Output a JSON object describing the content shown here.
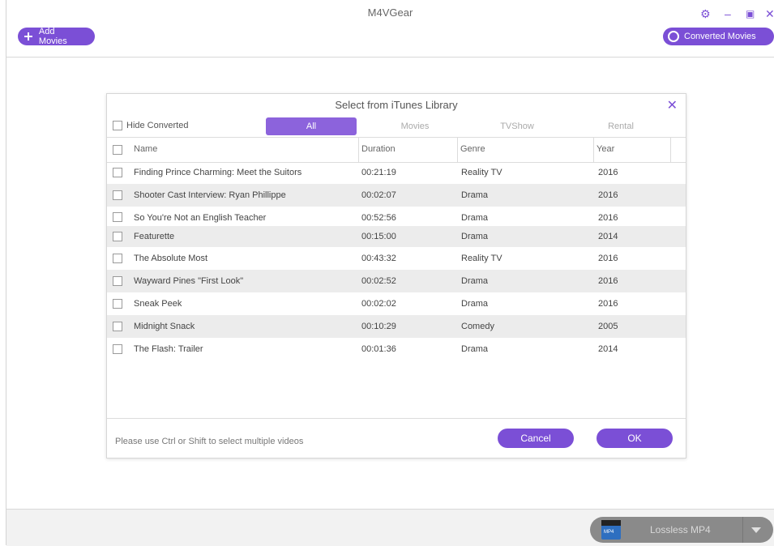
{
  "app": {
    "title": "M4VGear",
    "add_movies_label": "Add Movies",
    "converted_movies_label": "Converted Movies",
    "accent_color": "#7b4fd6"
  },
  "window_controls": {
    "settings_icon": "gear-icon",
    "minimize_icon": "minimize-icon",
    "maximize_icon": "maximize-icon",
    "close_icon": "close-icon"
  },
  "dialog": {
    "title": "Select from iTunes Library",
    "hide_converted_label": "Hide Converted",
    "tabs": [
      {
        "label": "All",
        "active": true
      },
      {
        "label": "Movies",
        "active": false
      },
      {
        "label": "TVShow",
        "active": false
      },
      {
        "label": "Rental",
        "active": false
      }
    ],
    "columns": [
      "Name",
      "Duration",
      "Genre",
      "Year"
    ],
    "rows": [
      {
        "name": "Finding Prince Charming: Meet the Suitors",
        "duration": "00:21:19",
        "genre": "Reality TV",
        "year": "2016"
      },
      {
        "name": "Shooter Cast Interview: Ryan Phillippe",
        "duration": "00:02:07",
        "genre": "Drama",
        "year": "2016"
      },
      {
        "name": "So You're Not an English Teacher",
        "duration": "00:52:56",
        "genre": "Drama",
        "year": "2016"
      },
      {
        "name": "Featurette",
        "duration": "00:15:00",
        "genre": "Drama",
        "year": "2014"
      },
      {
        "name": "The Absolute Most",
        "duration": "00:43:32",
        "genre": "Reality TV",
        "year": "2016"
      },
      {
        "name": "Wayward Pines \"First Look\"",
        "duration": "00:02:52",
        "genre": "Drama",
        "year": "2016"
      },
      {
        "name": "Sneak Peek",
        "duration": "00:02:02",
        "genre": "Drama",
        "year": "2016"
      },
      {
        "name": "Midnight Snack",
        "duration": "00:10:29",
        "genre": "Comedy",
        "year": "2005"
      },
      {
        "name": "The Flash: Trailer",
        "duration": "00:01:36",
        "genre": "Drama",
        "year": "2014"
      }
    ],
    "hint": "Please use Ctrl or Shift to select multiple videos",
    "cancel_label": "Cancel",
    "ok_label": "OK"
  },
  "output_format": {
    "icon_text": "MP4",
    "label": "Lossless MP4"
  }
}
